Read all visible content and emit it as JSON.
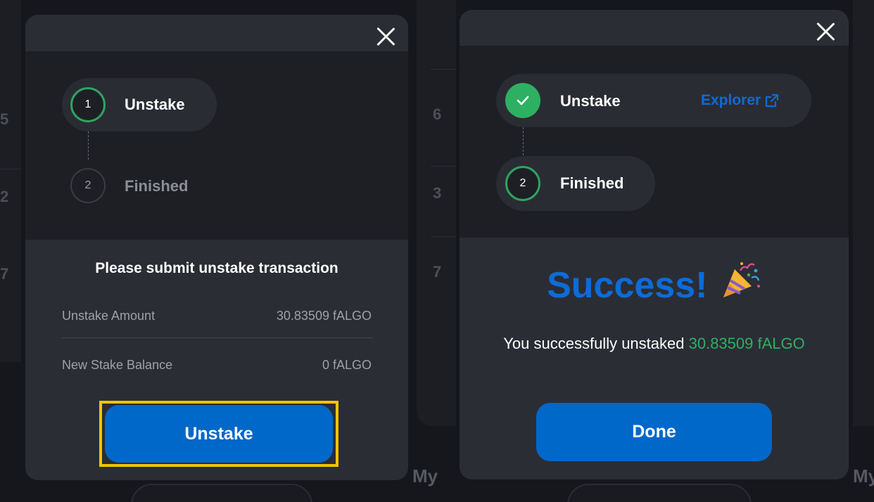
{
  "left_modal": {
    "steps": [
      {
        "number": "1",
        "label": "Unstake"
      },
      {
        "number": "2",
        "label": "Finished"
      }
    ],
    "title": "Please submit unstake transaction",
    "rows": [
      {
        "label": "Unstake Amount",
        "value": "30.83509 fALGO"
      },
      {
        "label": "New Stake Balance",
        "value": "0 fALGO"
      }
    ],
    "button_label": "Unstake"
  },
  "right_modal": {
    "steps": [
      {
        "label": "Unstake",
        "link": "Explorer"
      },
      {
        "number": "2",
        "label": "Finished"
      }
    ],
    "success_title": "Success!",
    "message_prefix": "You successfully unstaked",
    "amount": "30.83509",
    "unit": "fALGO",
    "button_label": "Done"
  },
  "background": {
    "left_numbers": [
      "5",
      "2",
      "7"
    ],
    "right_numbers": [
      "6",
      "3",
      "7"
    ],
    "my_label": "My"
  },
  "colors": {
    "accent_blue": "#0068c9",
    "success_green": "#2eb062",
    "highlight": "#f5c400"
  }
}
